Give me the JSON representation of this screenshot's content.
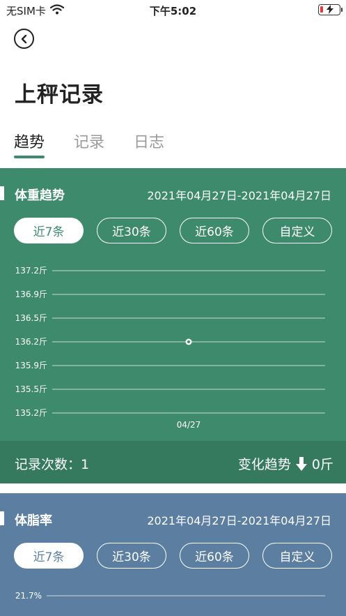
{
  "status": {
    "carrier": "无SIM卡",
    "time": "下午5:02"
  },
  "page": {
    "title": "上秤记录"
  },
  "tabs": [
    {
      "label": "趋势",
      "active": true
    },
    {
      "label": "记录",
      "active": false
    },
    {
      "label": "日志",
      "active": false
    }
  ],
  "colors": {
    "weight_card": "#3e8a6c",
    "fat_card": "#5b7ea1",
    "tab_indicator": "#3e8a6c"
  },
  "weight_card": {
    "title": "体重趋势",
    "date_range": "2021年04月27日-2021年04月27日",
    "chips": [
      "近7条",
      "近30条",
      "近60条",
      "自定义"
    ],
    "active_chip": "近7条",
    "record_count_label": "记录次数：",
    "record_count": "1",
    "trend_label": "变化趋势",
    "trend_value": "0斤"
  },
  "fat_card": {
    "title": "体脂率",
    "date_range": "2021年04月27日-2021年04月27日",
    "chips": [
      "近7条",
      "近30条",
      "近60条",
      "自定义"
    ],
    "active_chip": "近7条"
  },
  "chart_data": [
    {
      "type": "line",
      "x": [
        "04/27"
      ],
      "series": [
        {
          "values": [
            136.2
          ]
        }
      ],
      "ytick_labels": [
        "137.2斤",
        "136.9斤",
        "136.5斤",
        "136.2斤",
        "135.9斤",
        "135.5斤",
        "135.2斤"
      ],
      "ylim": [
        135.2,
        137.2
      ],
      "grid": true
    },
    {
      "type": "line",
      "x": [],
      "series": [],
      "ytick_labels": [
        "21.7%"
      ],
      "grid": true
    }
  ]
}
